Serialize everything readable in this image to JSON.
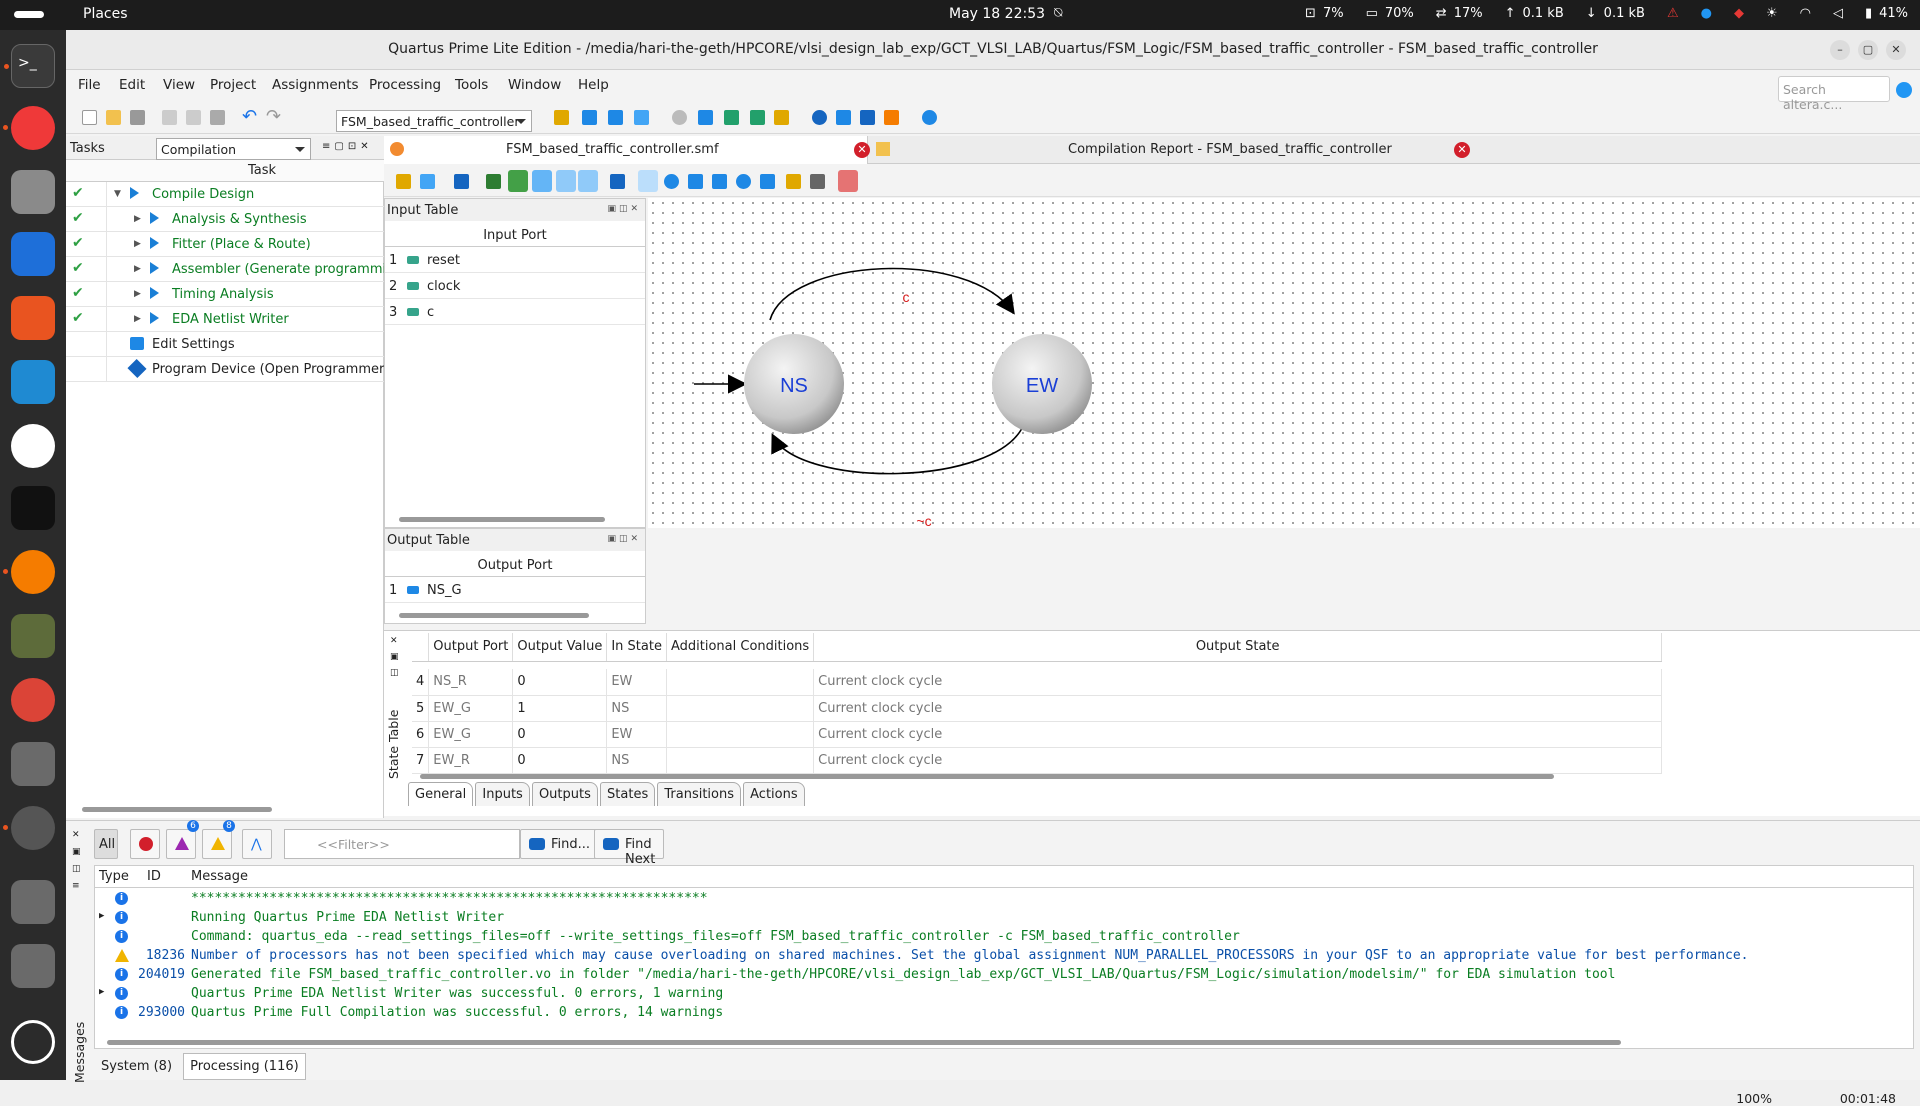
{
  "topbar": {
    "places": "Places",
    "datetime": "May 18  22:53",
    "cpu": "7%",
    "mem": "70%",
    "swap": "17%",
    "up": "0.1 kB",
    "down": "0.1 kB",
    "battery": "41%"
  },
  "window": {
    "title": "Quartus Prime Lite Edition - /media/hari-the-geth/HPCORE/vlsi_design_lab_exp/GCT_VLSI_LAB/Quartus/FSM_Logic/FSM_based_traffic_controller - FSM_based_traffic_controller"
  },
  "menu": [
    "File",
    "Edit",
    "View",
    "Project",
    "Assignments",
    "Processing",
    "Tools",
    "Window",
    "Help"
  ],
  "search_placeholder": "Search altera.c...",
  "project_select": "FSM_based_traffic_controller",
  "tasks": {
    "label": "Tasks",
    "mode": "Compilation",
    "column": "Task",
    "items": [
      "Compile Design",
      "Analysis & Synthesis",
      "Fitter (Place & Route)",
      "Assembler (Generate programming files)",
      "Timing Analysis",
      "EDA Netlist Writer",
      "Edit Settings",
      "Program Device (Open Programmer)"
    ]
  },
  "doc_tabs": {
    "smf": "FSM_based_traffic_controller.smf",
    "report": "Compilation Report - FSM_based_traffic_controller"
  },
  "input_table": {
    "title": "Input Table",
    "header": "Input Port",
    "ports": [
      "reset",
      "clock",
      "c"
    ]
  },
  "output_table": {
    "title": "Output Table",
    "header": "Output Port",
    "ports": [
      "NS_G"
    ]
  },
  "diagram": {
    "states": [
      "NS",
      "EW"
    ],
    "transitions": [
      "c",
      "~c"
    ]
  },
  "state_table": {
    "label": "State Table",
    "headers": [
      "Output Port",
      "Output Value",
      "In State",
      "Additional Conditions",
      "Output State"
    ],
    "rows": [
      {
        "n": "4",
        "port": "NS_R",
        "value": "0",
        "state": "EW",
        "cond": "",
        "out": "Current clock cycle"
      },
      {
        "n": "5",
        "port": "EW_G",
        "value": "1",
        "state": "NS",
        "cond": "",
        "out": "Current clock cycle"
      },
      {
        "n": "6",
        "port": "EW_G",
        "value": "0",
        "state": "EW",
        "cond": "",
        "out": "Current clock cycle"
      },
      {
        "n": "7",
        "port": "EW_R",
        "value": "0",
        "state": "NS",
        "cond": "",
        "out": "Current clock cycle"
      }
    ],
    "tabs": [
      "General",
      "Inputs",
      "Outputs",
      "States",
      "Transitions",
      "Actions"
    ]
  },
  "messages": {
    "all": "All",
    "badge_critical": "6",
    "badge_warning": "8",
    "filter": "<<Filter>>",
    "find": "Find...",
    "find_next": "Find Next",
    "headers": [
      "Type",
      "ID",
      "Message"
    ],
    "rows": [
      {
        "type": "info",
        "id": "",
        "msg": "******************************************************************"
      },
      {
        "type": "info",
        "id": "",
        "msg": "Running Quartus Prime EDA Netlist Writer"
      },
      {
        "type": "info",
        "id": "",
        "msg": "Command: quartus_eda --read_settings_files=off --write_settings_files=off FSM_based_traffic_controller -c FSM_based_traffic_controller"
      },
      {
        "type": "warn",
        "id": "18236",
        "msg": "Number of processors has not been specified which may cause overloading on shared machines.  Set the global assignment NUM_PARALLEL_PROCESSORS in your QSF to an appropriate value for best performance."
      },
      {
        "type": "info",
        "id": "204019",
        "msg": "Generated file FSM_based_traffic_controller.vo in folder \"/media/hari-the-geth/HPCORE/vlsi_design_lab_exp/GCT_VLSI_LAB/Quartus/FSM_Logic/simulation/modelsim/\" for EDA simulation tool"
      },
      {
        "type": "info",
        "id": "",
        "msg": "Quartus Prime EDA Netlist Writer was successful. 0 errors, 1 warning"
      },
      {
        "type": "info",
        "id": "293000",
        "msg": "Quartus Prime Full Compilation was successful. 0 errors, 14 warnings"
      }
    ],
    "tabs": [
      "System (8)",
      "Processing (116)"
    ],
    "label": "Messages"
  },
  "status": {
    "zoom": "100%",
    "elapsed": "00:01:48"
  }
}
